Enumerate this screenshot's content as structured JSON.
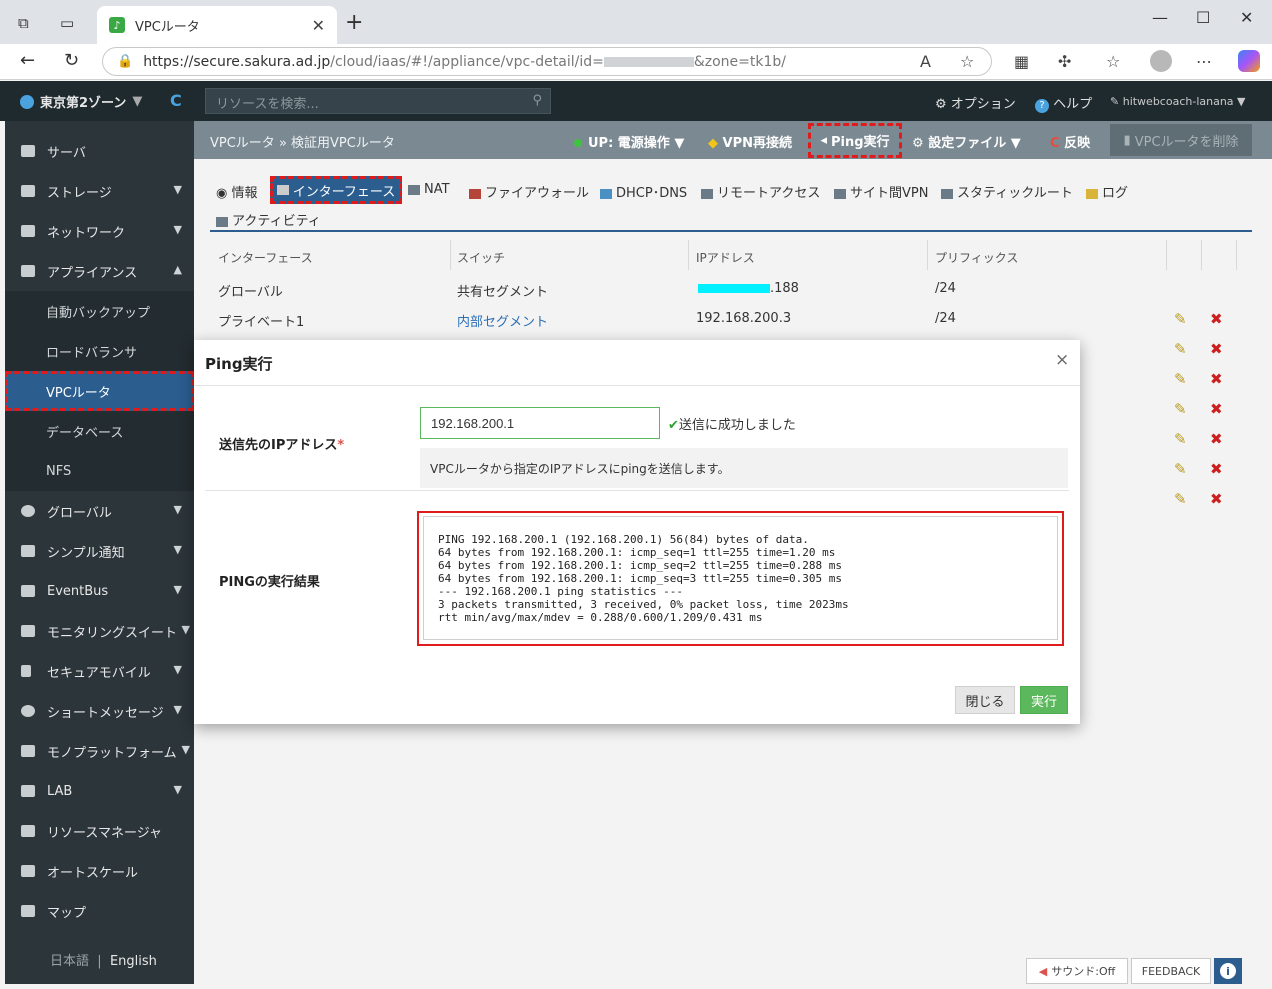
{
  "browser": {
    "tab_title": "VPCルータ",
    "url_prefix": "https://secure.sakura.ad.jp",
    "url_rest": "/cloud/iaas/#!/appliance/vpc-detail/id=",
    "url_suffix": "&zone=tk1b/"
  },
  "topbar": {
    "zone": "東京第2ゾーン",
    "search_placeholder": "リソースを検索...",
    "option": "オプション",
    "help": "ヘルプ",
    "user": "hitwebcoach-lanana"
  },
  "sidebar": {
    "items": [
      {
        "label": "サーバ"
      },
      {
        "label": "ストレージ"
      },
      {
        "label": "ネットワーク"
      },
      {
        "label": "アプライアンス"
      },
      {
        "label": "グローバル"
      },
      {
        "label": "シンプル通知"
      },
      {
        "label": "EventBus"
      },
      {
        "label": "モニタリングスイート"
      },
      {
        "label": "セキュアモバイル"
      },
      {
        "label": "ショートメッセージ"
      },
      {
        "label": "モノプラットフォーム"
      },
      {
        "label": "LAB"
      },
      {
        "label": "リソースマネージャ"
      },
      {
        "label": "オートスケール"
      },
      {
        "label": "マップ"
      }
    ],
    "sub": [
      {
        "label": "自動バックアップ"
      },
      {
        "label": "ロードバランサ"
      },
      {
        "label": "VPCルータ"
      },
      {
        "label": "データベース"
      },
      {
        "label": "NFS"
      }
    ],
    "lang_ja": "日本語",
    "lang_sep": "|",
    "lang_en": "English"
  },
  "crumb": {
    "text": "VPCルータ » 検証用VPCルータ"
  },
  "actions": {
    "power": "UP: 電源操作 ▼",
    "vpn": "VPN再接続",
    "ping": "Ping実行",
    "config": "設定ファイル ▼",
    "apply": "反映",
    "delete": "VPCルータを削除"
  },
  "subtabs": {
    "info": "情報",
    "interface": "インターフェース",
    "nat": "NAT",
    "firewall": "ファイアウォール",
    "dhcp": "DHCP･DNS",
    "remote": "リモートアクセス",
    "site": "サイト間VPN",
    "static": "スタティックルート",
    "log": "ログ",
    "activity": "アクティビティ"
  },
  "table": {
    "headers": [
      "インターフェース",
      "スイッチ",
      "IPアドレス",
      "プリフィックス"
    ],
    "rows": [
      {
        "if": "グローバル",
        "switch": "共有セグメント",
        "ip": ".188",
        "prefix": "/24"
      },
      {
        "if": "プライベート1",
        "switch": "内部セグメント",
        "ip": "192.168.200.3",
        "prefix": "/24"
      }
    ]
  },
  "modal": {
    "title": "Ping実行",
    "close": "×",
    "dest_label": "送信先のIPアドレス",
    "required": "*",
    "ip_value": "192.168.200.1",
    "success": "送信に成功しました",
    "help": "VPCルータから指定のIPアドレスにpingを送信します。",
    "result_label": "PINGの実行結果",
    "result": "PING 192.168.200.1 (192.168.200.1) 56(84) bytes of data.\n64 bytes from 192.168.200.1: icmp_seq=1 ttl=255 time=1.20 ms\n64 bytes from 192.168.200.1: icmp_seq=2 ttl=255 time=0.288 ms\n64 bytes from 192.168.200.1: icmp_seq=3 ttl=255 time=0.305 ms\n--- 192.168.200.1 ping statistics ---\n3 packets transmitted, 3 received, 0% packet loss, time 2023ms\nrtt min/avg/max/mdev = 0.288/0.600/1.209/0.431 ms",
    "btn_close": "閉じる",
    "btn_exec": "実行"
  },
  "footer": {
    "sound": "サウンド:Off",
    "feedback": "FEEDBACK",
    "info": "i"
  }
}
